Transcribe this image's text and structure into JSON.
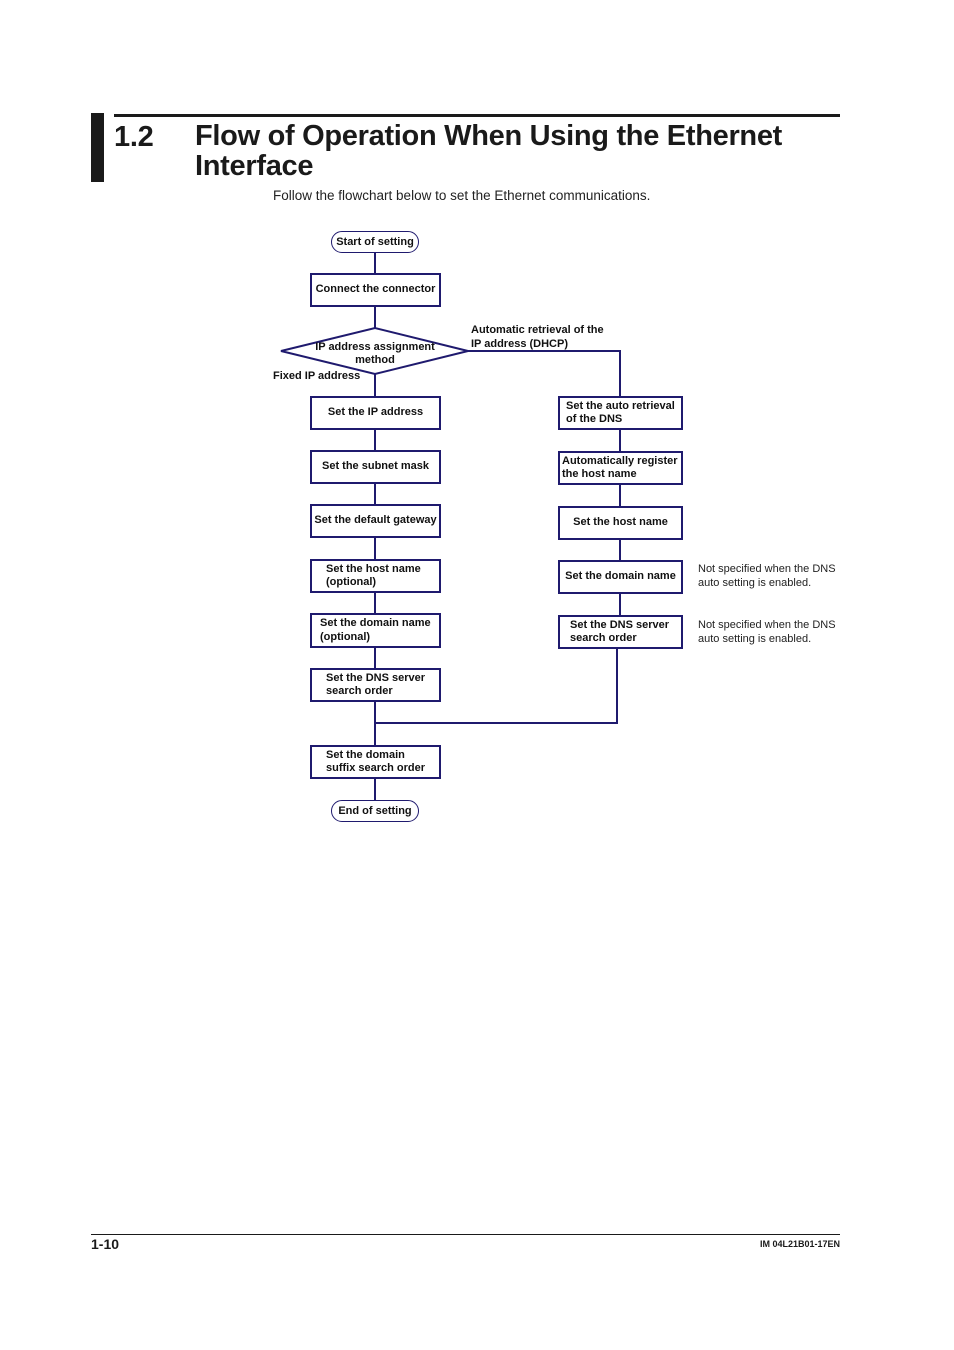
{
  "header": {
    "section_number": "1.2",
    "section_title": "Flow of Operation When Using the Ethernet Interface",
    "intro": "Follow the flowchart below to set the Ethernet communications."
  },
  "flowchart": {
    "start": "Start of setting",
    "connect": "Connect the connector",
    "decision": "IP address assignment method",
    "branch_fixed_label": "Fixed IP address",
    "branch_dhcp_label": "Automatic retrieval of the IP address (DHCP)",
    "fixed_steps": [
      "Set the IP address",
      "Set the subnet mask",
      "Set the default gateway",
      "Set the host name (optional)",
      "Set the domain name (optional)",
      "Set the DNS server search order"
    ],
    "dhcp_steps": [
      "Set the auto retrieval of the DNS",
      "Automatically register the host name",
      "Set the host name",
      "Set the domain name",
      "Set the DNS server search order"
    ],
    "dhcp_notes": [
      "Not specified when the DNS auto setting is enabled.",
      "Not specified when the DNS auto setting is enabled."
    ],
    "merge_step": "Set the domain suffix search order",
    "end": "End of setting",
    "line_color": "#1f1a6e"
  },
  "footer": {
    "page_number": "1-10",
    "doc_id": "IM 04L21B01-17EN"
  }
}
